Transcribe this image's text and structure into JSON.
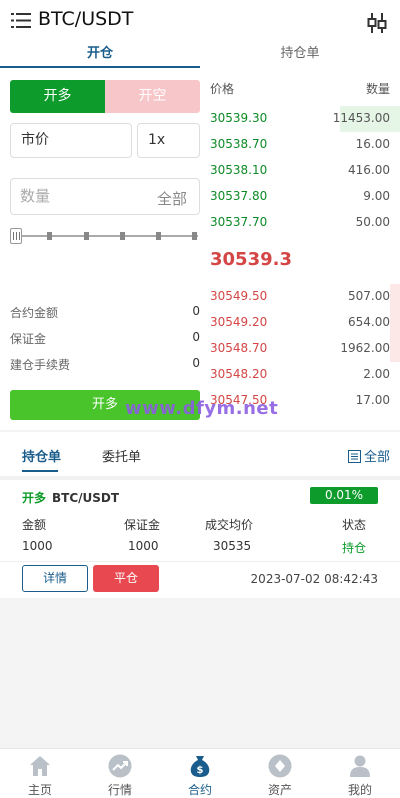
{
  "header": {
    "title": "BTC/USDT",
    "menu_icon": "hamburger-menu-icon",
    "filter_icon": "candlestick-filter-icon"
  },
  "tabs": [
    {
      "label": "开仓",
      "active": true
    },
    {
      "label": "持仓单",
      "active": false
    }
  ],
  "trade": {
    "long_label": "开多",
    "short_label": "开空",
    "price_type": "市价",
    "leverage": "1x",
    "quantity_placeholder": "数量",
    "quantity_all": "全部",
    "slider_level": 0,
    "contract_amount_label": "合约金额",
    "contract_amount": "0",
    "margin_label": "保证金",
    "margin": "0",
    "open_fee_label": "建仓手续费",
    "open_fee": "0",
    "submit_label": "开多"
  },
  "orderbook": {
    "price_header": "价格",
    "qty_header": "数量",
    "asks": [
      {
        "price": "30539.30",
        "qty": "11453.00",
        "depth": 0.3
      },
      {
        "price": "30538.70",
        "qty": "16.00",
        "depth": 0
      },
      {
        "price": "30538.10",
        "qty": "416.00",
        "depth": 0
      },
      {
        "price": "30537.80",
        "qty": "9.00",
        "depth": 0
      },
      {
        "price": "30537.70",
        "qty": "50.00",
        "depth": 0
      }
    ],
    "last_price": "30539.3",
    "bids": [
      {
        "price": "30549.50",
        "qty": "507.00",
        "depth": 0.05
      },
      {
        "price": "30549.20",
        "qty": "654.00",
        "depth": 0.05
      },
      {
        "price": "30548.70",
        "qty": "1962.00",
        "depth": 0.05
      },
      {
        "price": "30548.20",
        "qty": "2.00",
        "depth": 0
      },
      {
        "price": "30547.50",
        "qty": "17.00",
        "depth": 0
      }
    ]
  },
  "watermark": "www.dfym.net",
  "positions": {
    "tab_positions": "持仓单",
    "tab_orders": "委托单",
    "all_label": "全部",
    "item": {
      "direction": "开多",
      "symbol": "BTC/USDT",
      "return_rate": "0.01%",
      "labels": [
        "金额",
        "保证金",
        "成交均价",
        "状态"
      ],
      "values": [
        "1000",
        "1000",
        "30535",
        "持仓"
      ],
      "detail_label": "详情",
      "close_label": "平仓",
      "time": "2023-07-02 08:42:43"
    }
  },
  "nav": [
    {
      "label": "主页",
      "icon": "home-icon",
      "active": false
    },
    {
      "label": "行情",
      "icon": "market-trend-icon",
      "active": false
    },
    {
      "label": "合约",
      "icon": "contract-money-bag-icon",
      "active": true
    },
    {
      "label": "资产",
      "icon": "assets-diamond-icon",
      "active": false
    },
    {
      "label": "我的",
      "icon": "profile-icon",
      "active": false
    }
  ],
  "colors": {
    "accent": "#1a5d8c",
    "buy": "#0d9b2b",
    "sell": "#d44646"
  }
}
